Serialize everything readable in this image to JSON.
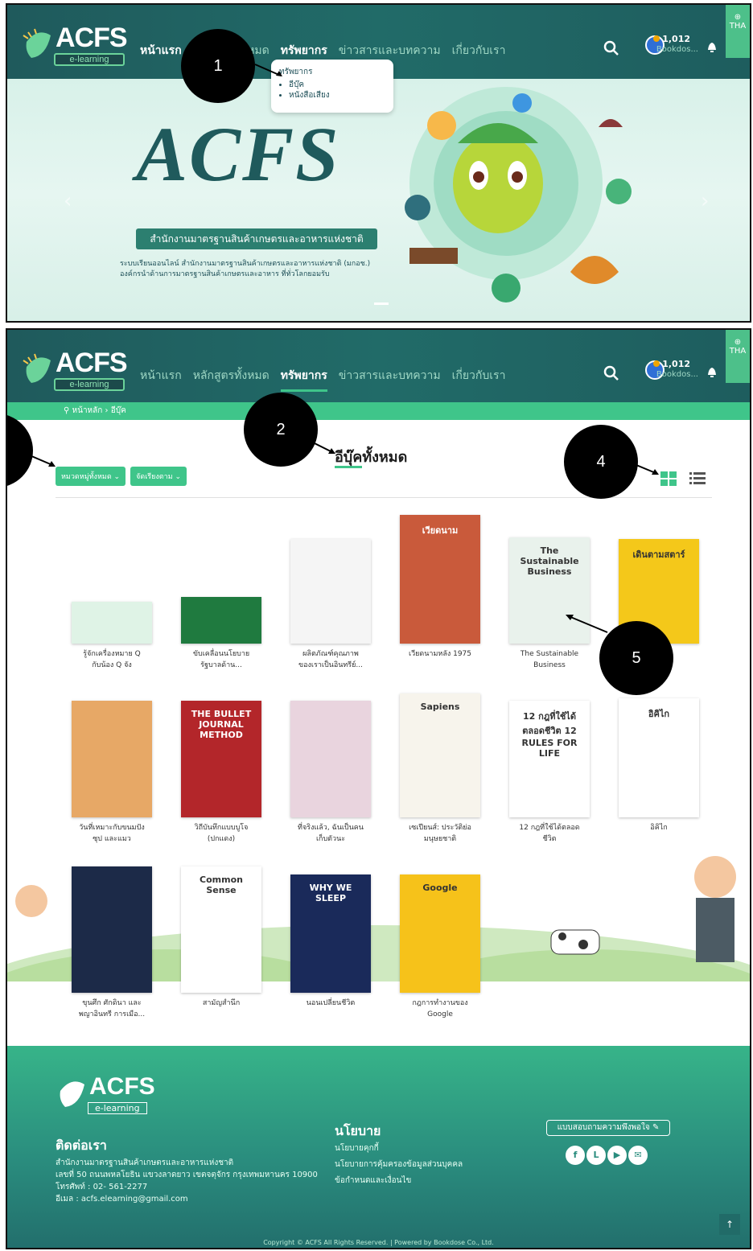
{
  "frame1": {
    "logo_word": "ACFS",
    "logo_sub": "e-learning",
    "nav": [
      "หน้าแรก",
      "หลักสูตรทั้งหมด",
      "ทรัพยากร",
      "ข่าวสารและบทความ",
      "เกี่ยวกับเรา"
    ],
    "coins": "1,012",
    "user": "Bookdos...",
    "lang": "THA",
    "dropdown": {
      "heading": "ทรัพยากร",
      "items": [
        "อีบุ๊ค",
        "หนังสือเสียง"
      ]
    },
    "banner_big": "ACFS",
    "banner_strip": "สำนักงานมาตรฐานสินค้าเกษตรและอาหารแห่งชาติ",
    "banner_desc": "ระบบเรียนออนไลน์ สำนักงานมาตรฐานสินค้าเกษตรและอาหารแห่งชาติ (มกอช.) องค์กรนำด้านการมาตรฐานสินค้าเกษตรและอาหาร ที่ทั่วโลกยอมรับ",
    "callout": "1"
  },
  "frame2": {
    "breadcrumb": {
      "home": "หน้าหลัก",
      "current": "อีบุ๊ค"
    },
    "title_part1": "อีบุ๊ค",
    "title_part2": "ทั้งหมด",
    "filters": [
      "หมวดหมู่ทั้งหมด",
      "จัดเรียงตาม"
    ],
    "callouts": [
      "2",
      "4",
      "5"
    ],
    "books": [
      {
        "t1": "รู้จักเครื่องหมาย Q",
        "t2": "กับน้อง Q จัง",
        "color": "#dff3e6"
      },
      {
        "t1": "ขับเคลื่อนนโยบาย",
        "t2": "รัฐบาลด้าน...",
        "color": "#1f7a3f"
      },
      {
        "t1": "ผลิตภัณฑ์คุณภาพ",
        "t2": "ของเราเป็นอินทรีย์...",
        "color": "#f5f5f5"
      },
      {
        "t1": "เวียดนามหลัง 1975",
        "t2": "",
        "color": "#c95a3b",
        "cover_text": "เวียดนาม"
      },
      {
        "t1": "The Sustainable",
        "t2": "Business",
        "color": "#e9f2ec",
        "cover_text": "The Sustainable Business"
      },
      {
        "t1": "",
        "t2": "",
        "color": "#f4c81a",
        "cover_text": "เดินตามสตาร์"
      },
      {
        "t1": "วันที่เหมาะกับขนมปัง",
        "t2": "ซุป และแมว",
        "color": "#e7a866"
      },
      {
        "t1": "วิถีบันทึกแบบบูโจ",
        "t2": "(ปกแดง)",
        "color": "#b3262a",
        "cover_text": "THE BULLET JOURNAL METHOD"
      },
      {
        "t1": "ที่จริงแล้ว, ฉันเป็นคน",
        "t2": "เก็บตัวนะ",
        "color": "#e9d4de"
      },
      {
        "t1": "เซเปียนส์: ประวัติย่อ",
        "t2": "มนุษยชาติ",
        "color": "#f7f4ec",
        "cover_text": "Sapiens"
      },
      {
        "t1": "12 กฎที่ใช้ได้ตลอด",
        "t2": "ชีวิต",
        "color": "#ffffff",
        "cover_text": "12 กฎที่ใช้ได้ ตลอดชีวิต 12 RULES FOR LIFE"
      },
      {
        "t1": "อิคิไก",
        "t2": "",
        "color": "#ffffff",
        "cover_text": "อิคิไก"
      },
      {
        "t1": "ขุนศึก ศักดินา และ",
        "t2": "พญาอินทรี การเมือ...",
        "color": "#1c2a48"
      },
      {
        "t1": "สามัญสำนึก",
        "t2": "",
        "color": "#ffffff",
        "cover_text": "Common Sense"
      },
      {
        "t1": "นอนเปลี่ยนชีวิต",
        "t2": "",
        "color": "#1a2a5a",
        "cover_text": "WHY WE SLEEP"
      },
      {
        "t1": "กฎการทำงานของ",
        "t2": "Google",
        "color": "#f6c21a",
        "cover_text": "Google"
      }
    ],
    "footer": {
      "contact_h": "ติดต่อเรา",
      "contact": [
        "สำนักงานมาตรฐานสินค้าเกษตรและอาหารแห่งชาติ",
        "เลขที่ 50 ถนนพหลโยธิน แขวงลาดยาว เขตจตุจักร กรุงเทพมหานคร 10900",
        "โทรศัพท์ : 02- 561-2277",
        "อีเมล : acfs.elearning@gmail.com"
      ],
      "policy_h": "นโยบาย",
      "policy": [
        "นโยบายคุกกี้",
        "นโยบายการคุ้มครองข้อมูลส่วนบุคคล",
        "ข้อกำหนดและเงื่อนไข"
      ],
      "survey": "แบบสอบถามความพึงพอใจ",
      "copyright": "Copyright © ACFS All Rights Reserved. | Powered by Bookdose Co., Ltd."
    }
  }
}
